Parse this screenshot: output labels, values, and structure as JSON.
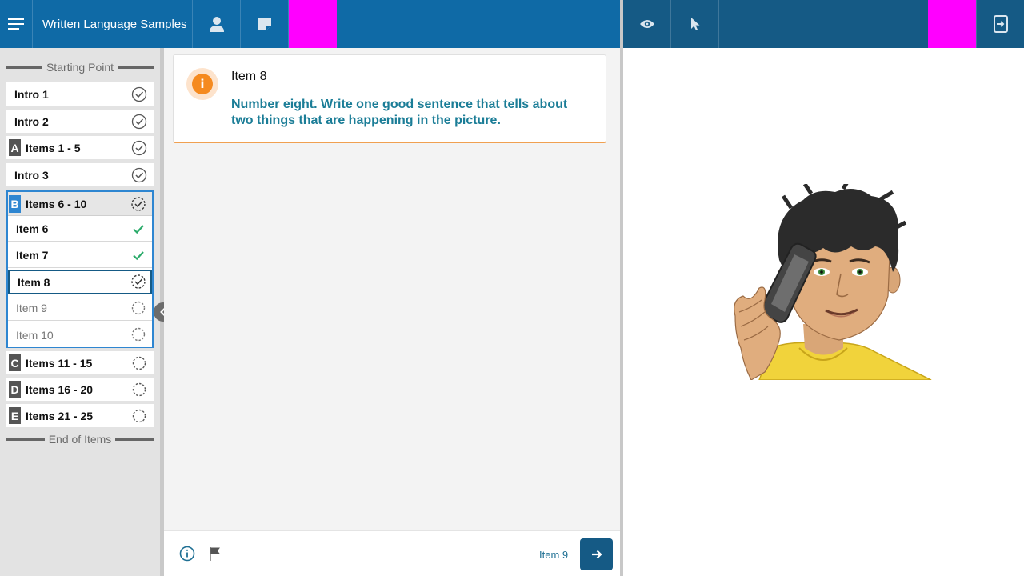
{
  "header": {
    "title": "Written Language Samples"
  },
  "sidebar": {
    "start_label": "Starting Point",
    "end_label": "End of Items",
    "items": [
      {
        "label": "Intro 1",
        "letter": "",
        "status": "done"
      },
      {
        "label": "Intro 2",
        "letter": "",
        "status": "done"
      },
      {
        "label": "Items 1 - 5",
        "letter": "A",
        "status": "done"
      },
      {
        "label": "Intro 3",
        "letter": "",
        "status": "done"
      }
    ],
    "group_b": {
      "letter": "B",
      "label": "Items 6 - 10",
      "status": "in-progress",
      "sub_items": [
        {
          "label": "Item 6",
          "status": "correct"
        },
        {
          "label": "Item 7",
          "status": "correct"
        },
        {
          "label": "Item 8",
          "status": "current"
        },
        {
          "label": "Item 9",
          "status": "pending"
        },
        {
          "label": "Item 10",
          "status": "pending"
        }
      ]
    },
    "later_items": [
      {
        "label": "Items 11 - 15",
        "letter": "C",
        "status": "pending"
      },
      {
        "label": "Items 16 - 20",
        "letter": "D",
        "status": "pending"
      },
      {
        "label": "Items 21 - 25",
        "letter": "E",
        "status": "pending"
      }
    ]
  },
  "card": {
    "title": "Item 8",
    "instruction": "Number eight. Write one good sentence that tells about two things that are happening in the picture."
  },
  "footer": {
    "next_label": "Item 9"
  },
  "colors": {
    "topbar_left": "#0f6aa6",
    "topbar_right": "#155a85",
    "highlight": "#ff00ff",
    "instruction_text": "#1b7d97",
    "accent_orange": "#f58a1f",
    "check_green": "#2bab6b"
  }
}
